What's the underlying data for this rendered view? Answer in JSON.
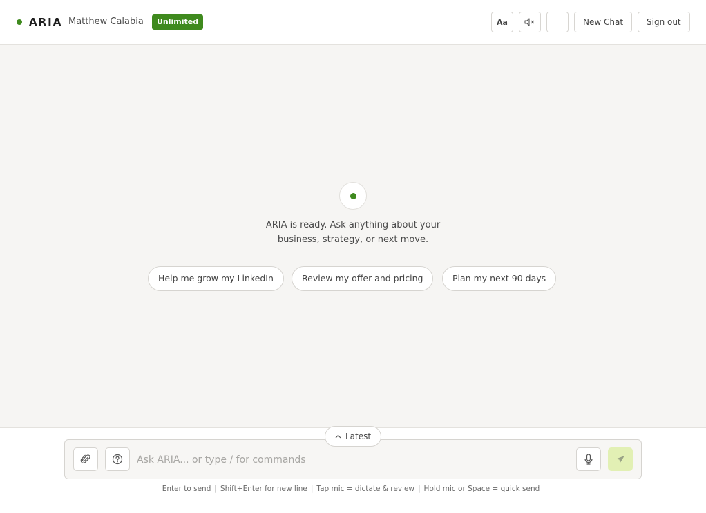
{
  "header": {
    "brand": "ARIA",
    "user_name": "Matthew Calabia",
    "plan_badge": "Unlimited",
    "font_button_label": "Aa",
    "new_chat_label": "New Chat",
    "sign_out_label": "Sign out",
    "status_color": "#3f8a1e"
  },
  "main": {
    "ready_text": "ARIA is ready. Ask anything about your business, strategy, or next move.",
    "suggestions": [
      {
        "label": "Help me grow my LinkedIn"
      },
      {
        "label": "Review my offer and pricing"
      },
      {
        "label": "Plan my next 90 days"
      }
    ]
  },
  "composer": {
    "latest_label": "Latest",
    "placeholder": "Ask ARIA... or type / for commands",
    "value": "",
    "send_color": "#e2f0b4"
  },
  "hints": [
    "Enter to send",
    "Shift+Enter for new line",
    "Tap mic = dictate & review",
    "Hold mic or Space = quick send"
  ],
  "icons": {
    "font_size": "font-size-icon",
    "mute": "speaker-muted-icon",
    "theme": "moon-icon",
    "attach": "paperclip-icon",
    "help": "help-circle-icon",
    "mic": "microphone-icon",
    "send": "send-icon",
    "latest": "chevron-up-icon"
  }
}
